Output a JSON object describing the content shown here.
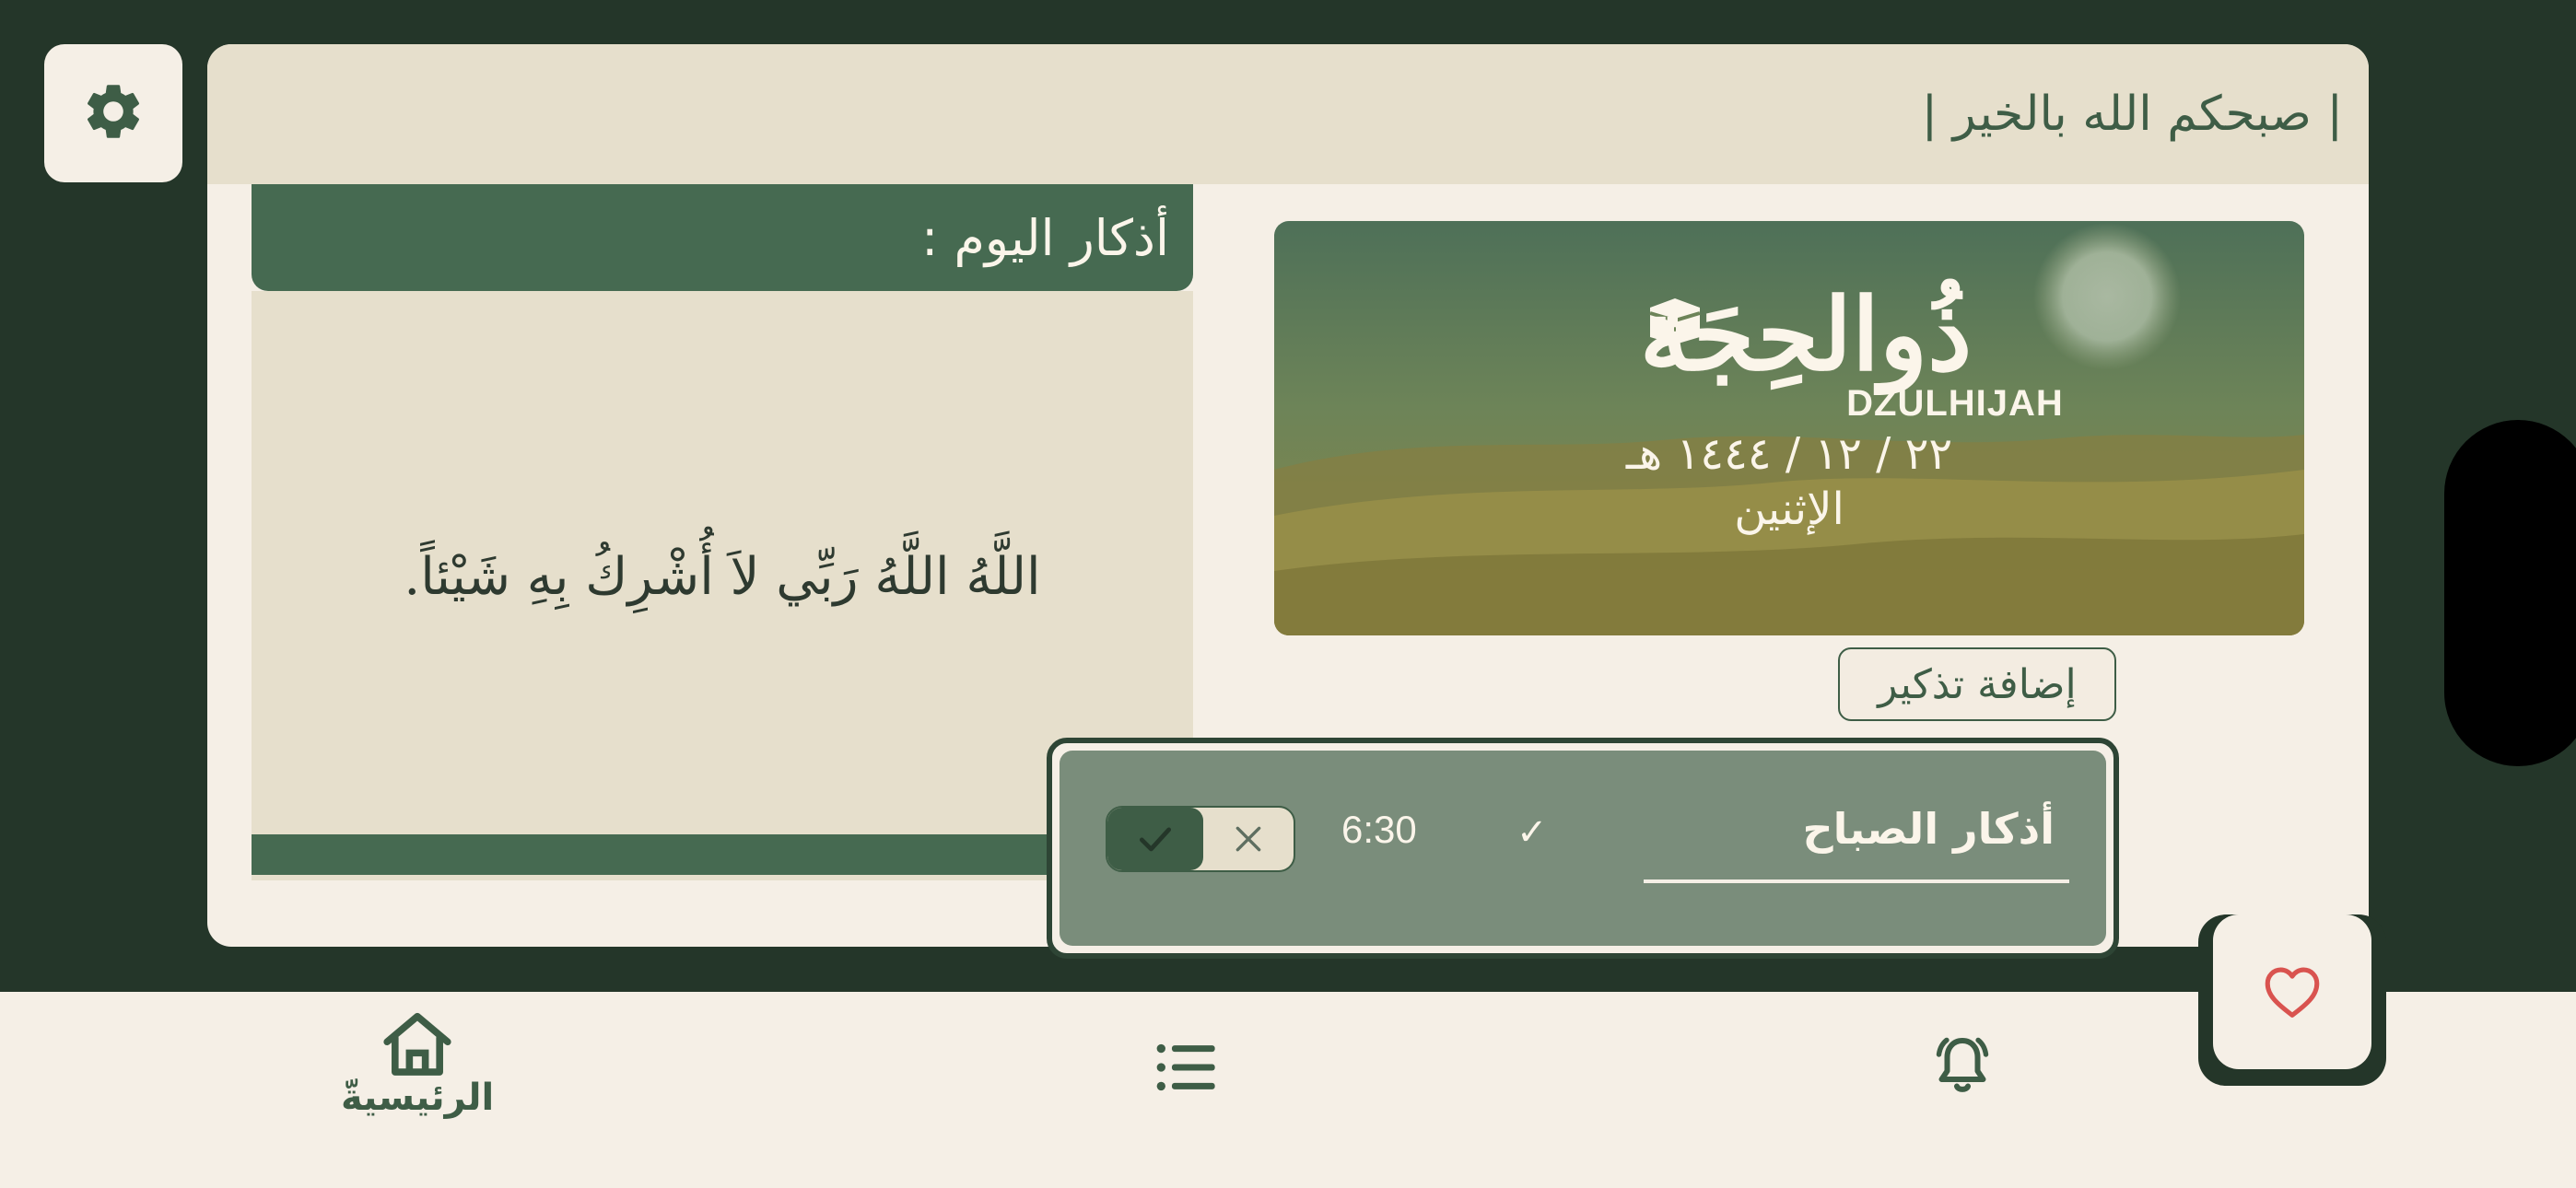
{
  "header": {
    "greeting": "| صبحكم الله بالخير |"
  },
  "hijri": {
    "month_ar": "ذُوالحِجَة",
    "month_en": "DZULHIJAH",
    "date": "٢٢ / ١٢ / ١٤٤٤ هـ",
    "day": "الإثنين"
  },
  "athkar": {
    "title": "أذكار اليوم :",
    "text": "اللَّهُ اللَّهُ رَبِّي لاَ أُشْرِكُ بِهِ شَيْئاً."
  },
  "reminders": {
    "add_label": "إضافة تذكير",
    "items": [
      {
        "title": "أذكار الصباح",
        "check": "✓",
        "time": "6:30",
        "enabled": true
      }
    ]
  },
  "nav": {
    "home_label": "الرئيسيةّ",
    "icons": [
      "home-icon",
      "list-icon",
      "bell-icon"
    ]
  },
  "colors": {
    "background": "#243629",
    "panel": "#f5efe6",
    "accent_green": "#466a51",
    "beige": "#e6dfcc",
    "heart": "#d9534f"
  }
}
